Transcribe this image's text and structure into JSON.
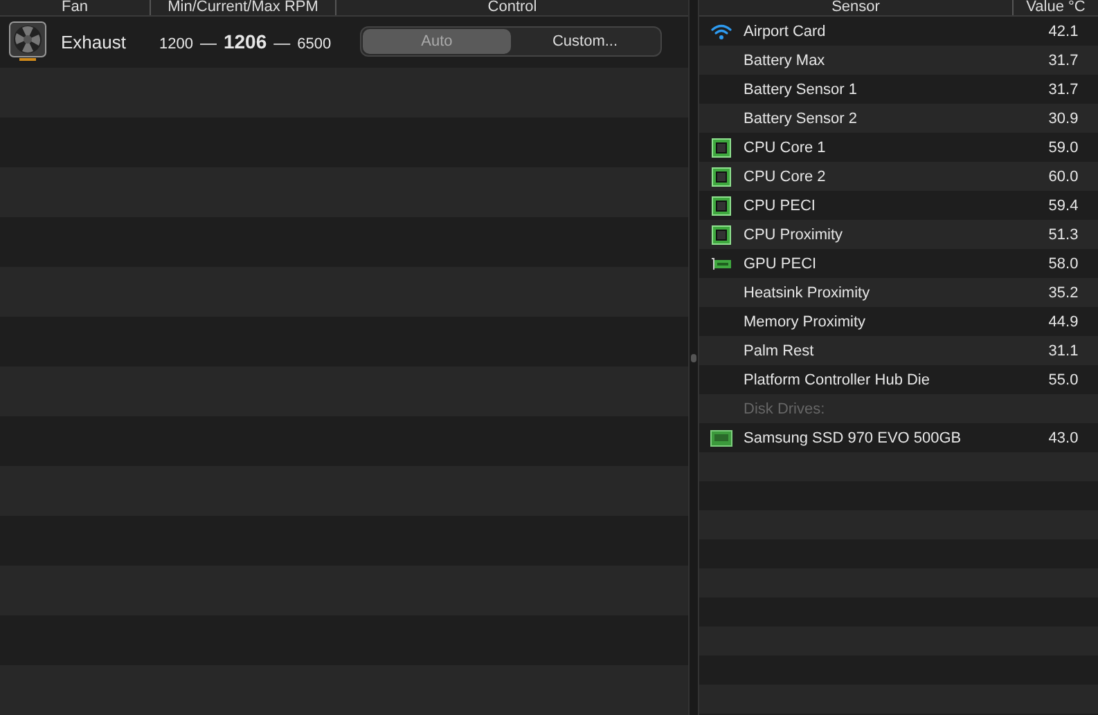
{
  "fans_table": {
    "columns": [
      "Fan",
      "Min/Current/Max RPM",
      "Control"
    ],
    "rows": [
      {
        "name": "Exhaust",
        "min": "1200",
        "current": "1206",
        "max": "6500",
        "separator": "—",
        "modes": [
          {
            "label": "Auto",
            "selected": true
          },
          {
            "label": "Custom...",
            "selected": false
          }
        ]
      }
    ]
  },
  "sensors_table": {
    "columns": [
      "Sensor",
      "Value °C"
    ],
    "rows": [
      {
        "kind": "wifi",
        "name": "Airport Card",
        "value": "42.1"
      },
      {
        "kind": "plain",
        "name": "Battery Max",
        "value": "31.7"
      },
      {
        "kind": "plain",
        "name": "Battery Sensor 1",
        "value": "31.7"
      },
      {
        "kind": "plain",
        "name": "Battery Sensor 2",
        "value": "30.9"
      },
      {
        "kind": "cpu",
        "name": "CPU Core 1",
        "value": "59.0"
      },
      {
        "kind": "cpu",
        "name": "CPU Core 2",
        "value": "60.0"
      },
      {
        "kind": "cpu",
        "name": "CPU PECI",
        "value": "59.4"
      },
      {
        "kind": "cpu",
        "name": "CPU Proximity",
        "value": "51.3"
      },
      {
        "kind": "gpu",
        "name": "GPU PECI",
        "value": "58.0"
      },
      {
        "kind": "plain",
        "name": "Heatsink Proximity",
        "value": "35.2"
      },
      {
        "kind": "plain",
        "name": "Memory Proximity",
        "value": "44.9"
      },
      {
        "kind": "plain",
        "name": "Palm Rest",
        "value": "31.1"
      },
      {
        "kind": "plain",
        "name": "Platform Controller Hub Die",
        "value": "55.0"
      },
      {
        "kind": "section",
        "name": "Disk Drives:"
      },
      {
        "kind": "ssd",
        "name": "Samsung SSD 970 EVO 500GB",
        "value": "43.0"
      }
    ]
  }
}
